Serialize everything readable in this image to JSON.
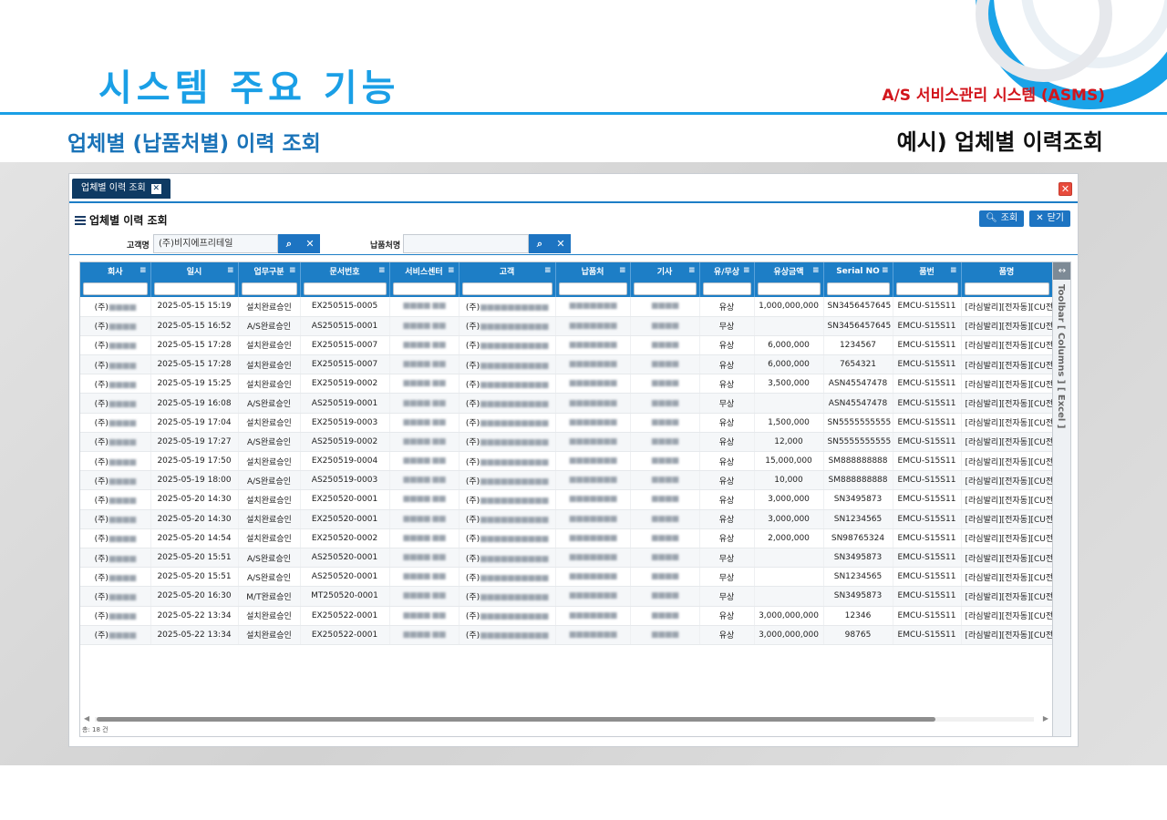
{
  "slide": {
    "title": "시스템 주요 기능",
    "system_name": "A/S 서비스관리 시스템 (ASMS)",
    "subtitle": "업체별 (납품처별) 이력 조회",
    "example_title": "예시) 업체별 이력조회"
  },
  "app": {
    "tab_label": "업체별 이력 조회",
    "screen_title": "업체별 이력 조회",
    "search_button": "조회",
    "close_button": "닫기",
    "customer_label": "고객명",
    "customer_value": "(주)비지에프리테일",
    "delivery_label": "납품처명",
    "delivery_value": "",
    "side_toolbar": "Toolbar [ Columns ] [ Excel ]",
    "total_count": "총: 18 건",
    "colors": {
      "header": "#1d7ec6",
      "tab": "#0e3a63",
      "title": "#1a9fe6",
      "accent_red": "#d2151c"
    },
    "columns": [
      "회사",
      "일시",
      "업무구분",
      "문서번호",
      "서비스센터",
      "고객",
      "납품처",
      "기사",
      "유/무상",
      "유상금액",
      "Serial NO",
      "품번",
      "품명"
    ],
    "rows": [
      [
        "(주)",
        "2025-05-15 15:19",
        "설치완료승인",
        "EX250515-0005",
        "",
        "(주)",
        "",
        "",
        "유상",
        "1,000,000,000",
        "SN3456457645",
        "EMCU-S15S11",
        "[라심발리][전자동][CU전용"
      ],
      [
        "(주)",
        "2025-05-15 16:52",
        "A/S완료승인",
        "AS250515-0001",
        "",
        "(주)",
        "",
        "",
        "무상",
        "",
        "SN3456457645",
        "EMCU-S15S11",
        "[라심발리][전자동][CU전용"
      ],
      [
        "(주)",
        "2025-05-15 17:28",
        "설치완료승인",
        "EX250515-0007",
        "",
        "(주)",
        "",
        "",
        "유상",
        "6,000,000",
        "1234567",
        "EMCU-S15S11",
        "[라심발리][전자동][CU전용"
      ],
      [
        "(주)",
        "2025-05-15 17:28",
        "설치완료승인",
        "EX250515-0007",
        "",
        "(주)",
        "",
        "",
        "유상",
        "6,000,000",
        "7654321",
        "EMCU-S15S11",
        "[라심발리][전자동][CU전용"
      ],
      [
        "(주)",
        "2025-05-19 15:25",
        "설치완료승인",
        "EX250519-0002",
        "",
        "(주)",
        "",
        "",
        "유상",
        "3,500,000",
        "ASN45547478",
        "EMCU-S15S11",
        "[라심발리][전자동][CU전용"
      ],
      [
        "(주)",
        "2025-05-19 16:08",
        "A/S완료승인",
        "AS250519-0001",
        "",
        "(주)",
        "",
        "",
        "무상",
        "",
        "ASN45547478",
        "EMCU-S15S11",
        "[라심발리][전자동][CU전용"
      ],
      [
        "(주)",
        "2025-05-19 17:04",
        "설치완료승인",
        "EX250519-0003",
        "",
        "(주)",
        "",
        "",
        "유상",
        "1,500,000",
        "SN5555555555",
        "EMCU-S15S11",
        "[라심발리][전자동][CU전용"
      ],
      [
        "(주)",
        "2025-05-19 17:27",
        "A/S완료승인",
        "AS250519-0002",
        "",
        "(주)",
        "",
        "",
        "유상",
        "12,000",
        "SN5555555555",
        "EMCU-S15S11",
        "[라심발리][전자동][CU전용"
      ],
      [
        "(주)",
        "2025-05-19 17:50",
        "설치완료승인",
        "EX250519-0004",
        "",
        "(주)",
        "",
        "",
        "유상",
        "15,000,000",
        "SM888888888",
        "EMCU-S15S11",
        "[라심발리][전자동][CU전용"
      ],
      [
        "(주)",
        "2025-05-19 18:00",
        "A/S완료승인",
        "AS250519-0003",
        "",
        "(주)",
        "",
        "",
        "유상",
        "10,000",
        "SM888888888",
        "EMCU-S15S11",
        "[라심발리][전자동][CU전용"
      ],
      [
        "(주)",
        "2025-05-20 14:30",
        "설치완료승인",
        "EX250520-0001",
        "",
        "(주)",
        "",
        "",
        "유상",
        "3,000,000",
        "SN3495873",
        "EMCU-S15S11",
        "[라심발리][전자동][CU전용"
      ],
      [
        "(주)",
        "2025-05-20 14:30",
        "설치완료승인",
        "EX250520-0001",
        "",
        "(주)",
        "",
        "",
        "유상",
        "3,000,000",
        "SN1234565",
        "EMCU-S15S11",
        "[라심발리][전자동][CU전용"
      ],
      [
        "(주)",
        "2025-05-20 14:54",
        "설치완료승인",
        "EX250520-0002",
        "",
        "(주)",
        "",
        "",
        "유상",
        "2,000,000",
        "SN98765324",
        "EMCU-S15S11",
        "[라심발리][전자동][CU전용"
      ],
      [
        "(주)",
        "2025-05-20 15:51",
        "A/S완료승인",
        "AS250520-0001",
        "",
        "(주)",
        "",
        "",
        "무상",
        "",
        "SN3495873",
        "EMCU-S15S11",
        "[라심발리][전자동][CU전용"
      ],
      [
        "(주)",
        "2025-05-20 15:51",
        "A/S완료승인",
        "AS250520-0001",
        "",
        "(주)",
        "",
        "",
        "무상",
        "",
        "SN1234565",
        "EMCU-S15S11",
        "[라심발리][전자동][CU전용"
      ],
      [
        "(주)",
        "2025-05-20 16:30",
        "M/T완료승인",
        "MT250520-0001",
        "",
        "(주)",
        "",
        "",
        "무상",
        "",
        "SN3495873",
        "EMCU-S15S11",
        "[라심발리][전자동][CU전용"
      ],
      [
        "(주)",
        "2025-05-22 13:34",
        "설치완료승인",
        "EX250522-0001",
        "",
        "(주)",
        "",
        "",
        "유상",
        "3,000,000,000",
        "12346",
        "EMCU-S15S11",
        "[라심발리][전자동][CU전용"
      ],
      [
        "(주)",
        "2025-05-22 13:34",
        "설치완료승인",
        "EX250522-0001",
        "",
        "(주)",
        "",
        "",
        "유상",
        "3,000,000,000",
        "98765",
        "EMCU-S15S11",
        "[라심발리][전자동][CU전용"
      ]
    ]
  }
}
